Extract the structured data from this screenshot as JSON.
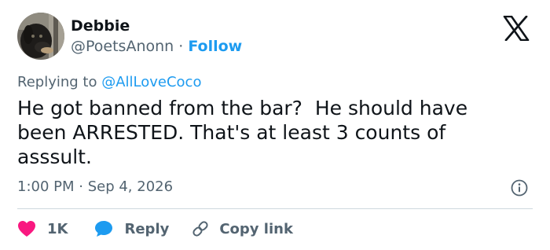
{
  "author": {
    "name": "Debbie",
    "handle": "@PoetsAnonn",
    "separator": "·",
    "follow_label": "Follow"
  },
  "reply_context": {
    "prefix": "Replying to ",
    "mention": "@AllLoveCoco"
  },
  "tweet": {
    "text": "He got banned from the bar?  He should have\nbeen ARRESTED. That's at least 3 counts of\nasssult.",
    "timestamp": "1:00 PM · Sep 4, 2026"
  },
  "actions": {
    "like_count": "1K",
    "reply_label": "Reply",
    "copy_label": "Copy link"
  },
  "icons": {
    "logo": "x-logo-icon",
    "info": "info-icon",
    "like": "heart-icon",
    "reply": "speech-bubble-icon",
    "copy": "link-icon"
  },
  "colors": {
    "accent": "#1d9bf0",
    "like": "#f91880",
    "text": "#0f1419",
    "muted": "#536471"
  }
}
